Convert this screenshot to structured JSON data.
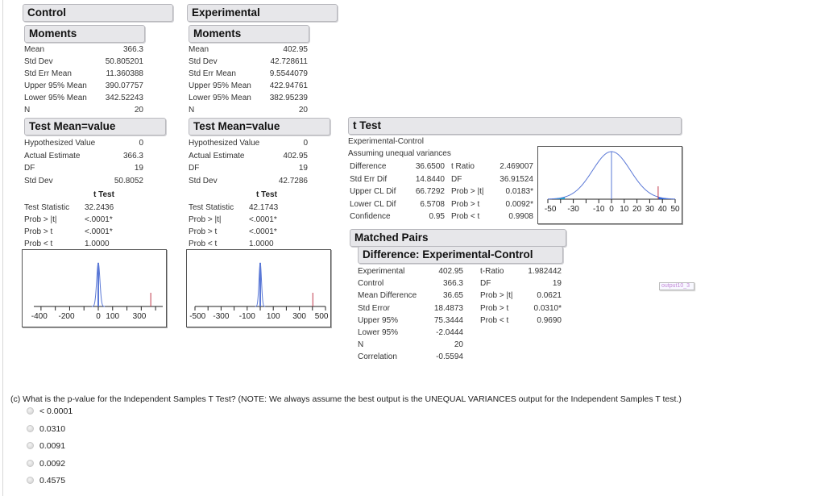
{
  "control": {
    "title": "Control",
    "moments_title": "Moments",
    "moments": [
      {
        "label": "Mean",
        "value": "366.3"
      },
      {
        "label": "Std Dev",
        "value": "50.805201"
      },
      {
        "label": "Std Err Mean",
        "value": "11.360388"
      },
      {
        "label": "Upper 95% Mean",
        "value": "390.07757"
      },
      {
        "label": "Lower 95% Mean",
        "value": "342.52243"
      },
      {
        "label": "N",
        "value": "20"
      }
    ],
    "test_title": "Test Mean=value",
    "test_rows": [
      {
        "label": "Hypothesized Value",
        "value": "0"
      },
      {
        "label": "Actual Estimate",
        "value": "366.3"
      },
      {
        "label": "DF",
        "value": "19"
      },
      {
        "label": "Std Dev",
        "value": "50.8052"
      }
    ],
    "ttest_heading": "t Test",
    "ttest_rows": [
      {
        "label": "Test Statistic",
        "value": "32.2436"
      },
      {
        "label": "Prob > |t|",
        "value": "<.0001*"
      },
      {
        "label": "Prob > t",
        "value": "<.0001*"
      },
      {
        "label": "Prob < t",
        "value": "1.0000"
      }
    ],
    "plot": {
      "ticks": [
        "-400",
        "-200",
        "0",
        "100",
        "300"
      ]
    }
  },
  "experimental": {
    "title": "Experimental",
    "moments_title": "Moments",
    "moments": [
      {
        "label": "Mean",
        "value": "402.95"
      },
      {
        "label": "Std Dev",
        "value": "42.728611"
      },
      {
        "label": "Std Err Mean",
        "value": "9.5544079"
      },
      {
        "label": "Upper 95% Mean",
        "value": "422.94761"
      },
      {
        "label": "Lower 95% Mean",
        "value": "382.95239"
      },
      {
        "label": "N",
        "value": "20"
      }
    ],
    "test_title": "Test Mean=value",
    "test_rows": [
      {
        "label": "Hypothesized Value",
        "value": "0"
      },
      {
        "label": "Actual Estimate",
        "value": "402.95"
      },
      {
        "label": "DF",
        "value": "19"
      },
      {
        "label": "Std Dev",
        "value": "42.7286"
      }
    ],
    "ttest_heading": "t Test",
    "ttest_rows": [
      {
        "label": "Test Statistic",
        "value": "42.1743"
      },
      {
        "label": "Prob > |t|",
        "value": "<.0001*"
      },
      {
        "label": "Prob > t",
        "value": "<.0001*"
      },
      {
        "label": "Prob < t",
        "value": "1.0000"
      }
    ],
    "plot": {
      "ticks": [
        "-500",
        "-300",
        "-100",
        "100",
        "300",
        "500"
      ]
    }
  },
  "ttest": {
    "title": "t Test",
    "subtitle": "Experimental-Control",
    "assumption": "Assuming unequal variances",
    "left_rows": [
      {
        "label": "Difference",
        "value": "36.6500"
      },
      {
        "label": "Std Err Dif",
        "value": "14.8440"
      },
      {
        "label": "Upper CL Dif",
        "value": "66.7292"
      },
      {
        "label": "Lower CL Dif",
        "value": "6.5708"
      },
      {
        "label": "Confidence",
        "value": "0.95"
      }
    ],
    "right_rows": [
      {
        "label": "t Ratio",
        "value": "2.469007"
      },
      {
        "label": "DF",
        "value": "36.91524"
      },
      {
        "label": "Prob > |t|",
        "value": "0.0183*"
      },
      {
        "label": "Prob > t",
        "value": "0.0092*"
      },
      {
        "label": "Prob < t",
        "value": "0.9908"
      }
    ],
    "plot": {
      "ticks": [
        "-50",
        "-30",
        "-10",
        "0",
        "10",
        "20",
        "30",
        "40",
        "50"
      ]
    }
  },
  "matched_pairs": {
    "title": "Matched Pairs",
    "diff_title": "Difference: Experimental-Control",
    "left_rows": [
      {
        "label": "Experimental",
        "value": "402.95"
      },
      {
        "label": "Control",
        "value": "366.3"
      },
      {
        "label": "Mean Difference",
        "value": "36.65"
      },
      {
        "label": "Std Error",
        "value": "18.4873"
      },
      {
        "label": "Upper 95%",
        "value": "75.3444"
      },
      {
        "label": "Lower 95%",
        "value": "-2.0444"
      },
      {
        "label": "N",
        "value": "20"
      },
      {
        "label": "Correlation",
        "value": "-0.5594"
      }
    ],
    "right_rows": [
      {
        "label": "t-Ratio",
        "value": "1.982442"
      },
      {
        "label": "DF",
        "value": "19"
      },
      {
        "label": "Prob > |t|",
        "value": "0.0621"
      },
      {
        "label": "Prob > t",
        "value": "0.0310*"
      },
      {
        "label": "Prob < t",
        "value": "0.9690"
      }
    ]
  },
  "image_tag": "output10_3",
  "question": {
    "text": "(c) What is the p-value for the Independent Samples T Test? (NOTE: We always assume the best output is the UNEQUAL VARIANCES output for the Independent Samples T test.)",
    "options": [
      "< 0.0001",
      "0.0310",
      "0.0091",
      "0.0092",
      "0.4575"
    ]
  },
  "colors": {
    "curve": "#5a78d6",
    "fill_left": "#1ca0c8",
    "fill_right": "#1f5fd8",
    "estimate_line": "#c0394b",
    "header_bg": "#e7e7ea"
  }
}
